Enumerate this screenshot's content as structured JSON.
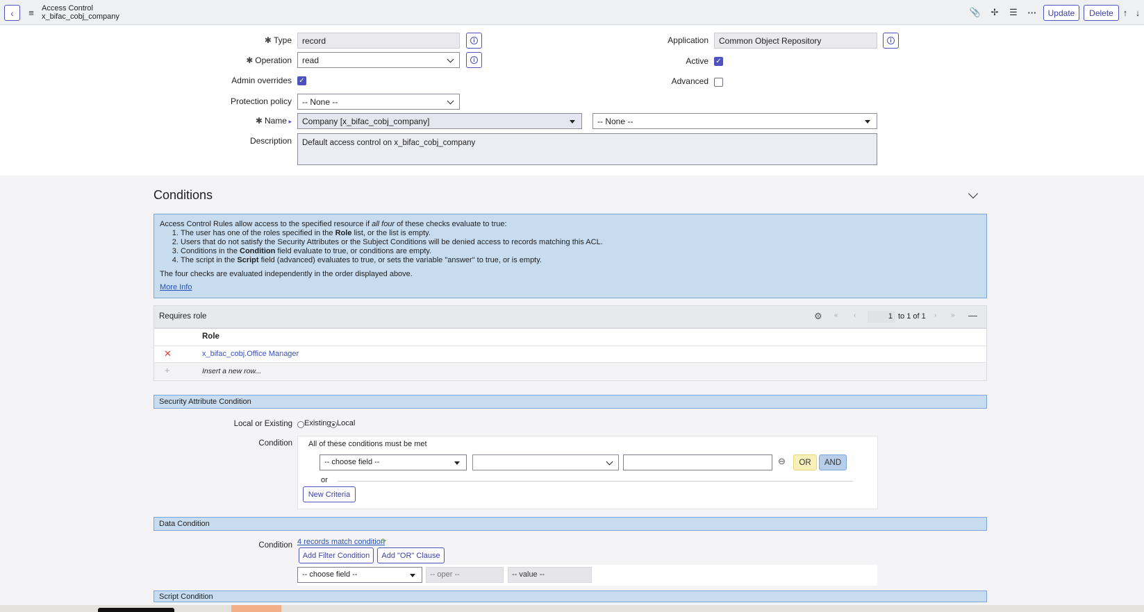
{
  "header": {
    "title_line1": "Access Control",
    "title_line2": "x_bifac_cobj_company",
    "update_label": "Update",
    "delete_label": "Delete"
  },
  "form": {
    "type_label": "Type",
    "type_value": "record",
    "operation_label": "Operation",
    "operation_value": "read",
    "admin_overrides_label": "Admin overrides",
    "protection_policy_label": "Protection policy",
    "protection_policy_value": "-- None --",
    "name_label": "Name",
    "name_value": "Company [x_bifac_cobj_company]",
    "name_field_value": "-- None --",
    "description_label": "Description",
    "description_value": "Default access control on x_bifac_cobj_company",
    "application_label": "Application",
    "application_value": "Common Object Repository",
    "active_label": "Active",
    "advanced_label": "Advanced"
  },
  "conditions": {
    "title": "Conditions",
    "info_intro_a": "Access Control Rules allow access to the specified resource if ",
    "info_intro_em": "all four",
    "info_intro_b": " of these checks evaluate to true:",
    "item1_a": "The user has one of the roles specified in the ",
    "item1_b": "Role",
    "item1_c": " list, or the list is empty.",
    "item2": "Users that do not satisfy the Security Attributes or the Subject Conditions will be denied access to records matching this ACL.",
    "item3_a": "Conditions in the ",
    "item3_b": "Condition",
    "item3_c": " field evaluate to true, or conditions are empty.",
    "item4_a": "The script in the ",
    "item4_b": "Script",
    "item4_c": " field (advanced) evaluates to true, or sets the variable \"answer\" to true, or is empty.",
    "info_footer": "The four checks are evaluated independently in the order displayed above.",
    "more_info": "More Info"
  },
  "requires_role": {
    "title": "Requires role",
    "page_number": "1",
    "range": "to 1 of 1",
    "col_role": "Role",
    "row1": "x_bifac_cobj.Office Manager",
    "insert_row": "Insert a new row..."
  },
  "security": {
    "bar_title": "Security Attribute Condition",
    "local_or_existing_label": "Local or Existing",
    "existing_label": "Existing",
    "local_label": "Local",
    "condition_label": "Condition",
    "all_met": "All of these conditions must be met",
    "choose_field": "-- choose field --",
    "or_button": "OR",
    "and_button": "AND",
    "or_text": "or",
    "new_criteria": "New Criteria"
  },
  "data_condition": {
    "bar_title": "Data Condition",
    "condition_label": "Condition",
    "records_match": "4 records match condition",
    "add_filter": "Add Filter Condition",
    "add_or": "Add \"OR\" Clause",
    "choose_field": "-- choose field --",
    "oper": "-- oper --",
    "value": "-- value --"
  },
  "script_condition": {
    "bar_title": "Script Condition"
  }
}
